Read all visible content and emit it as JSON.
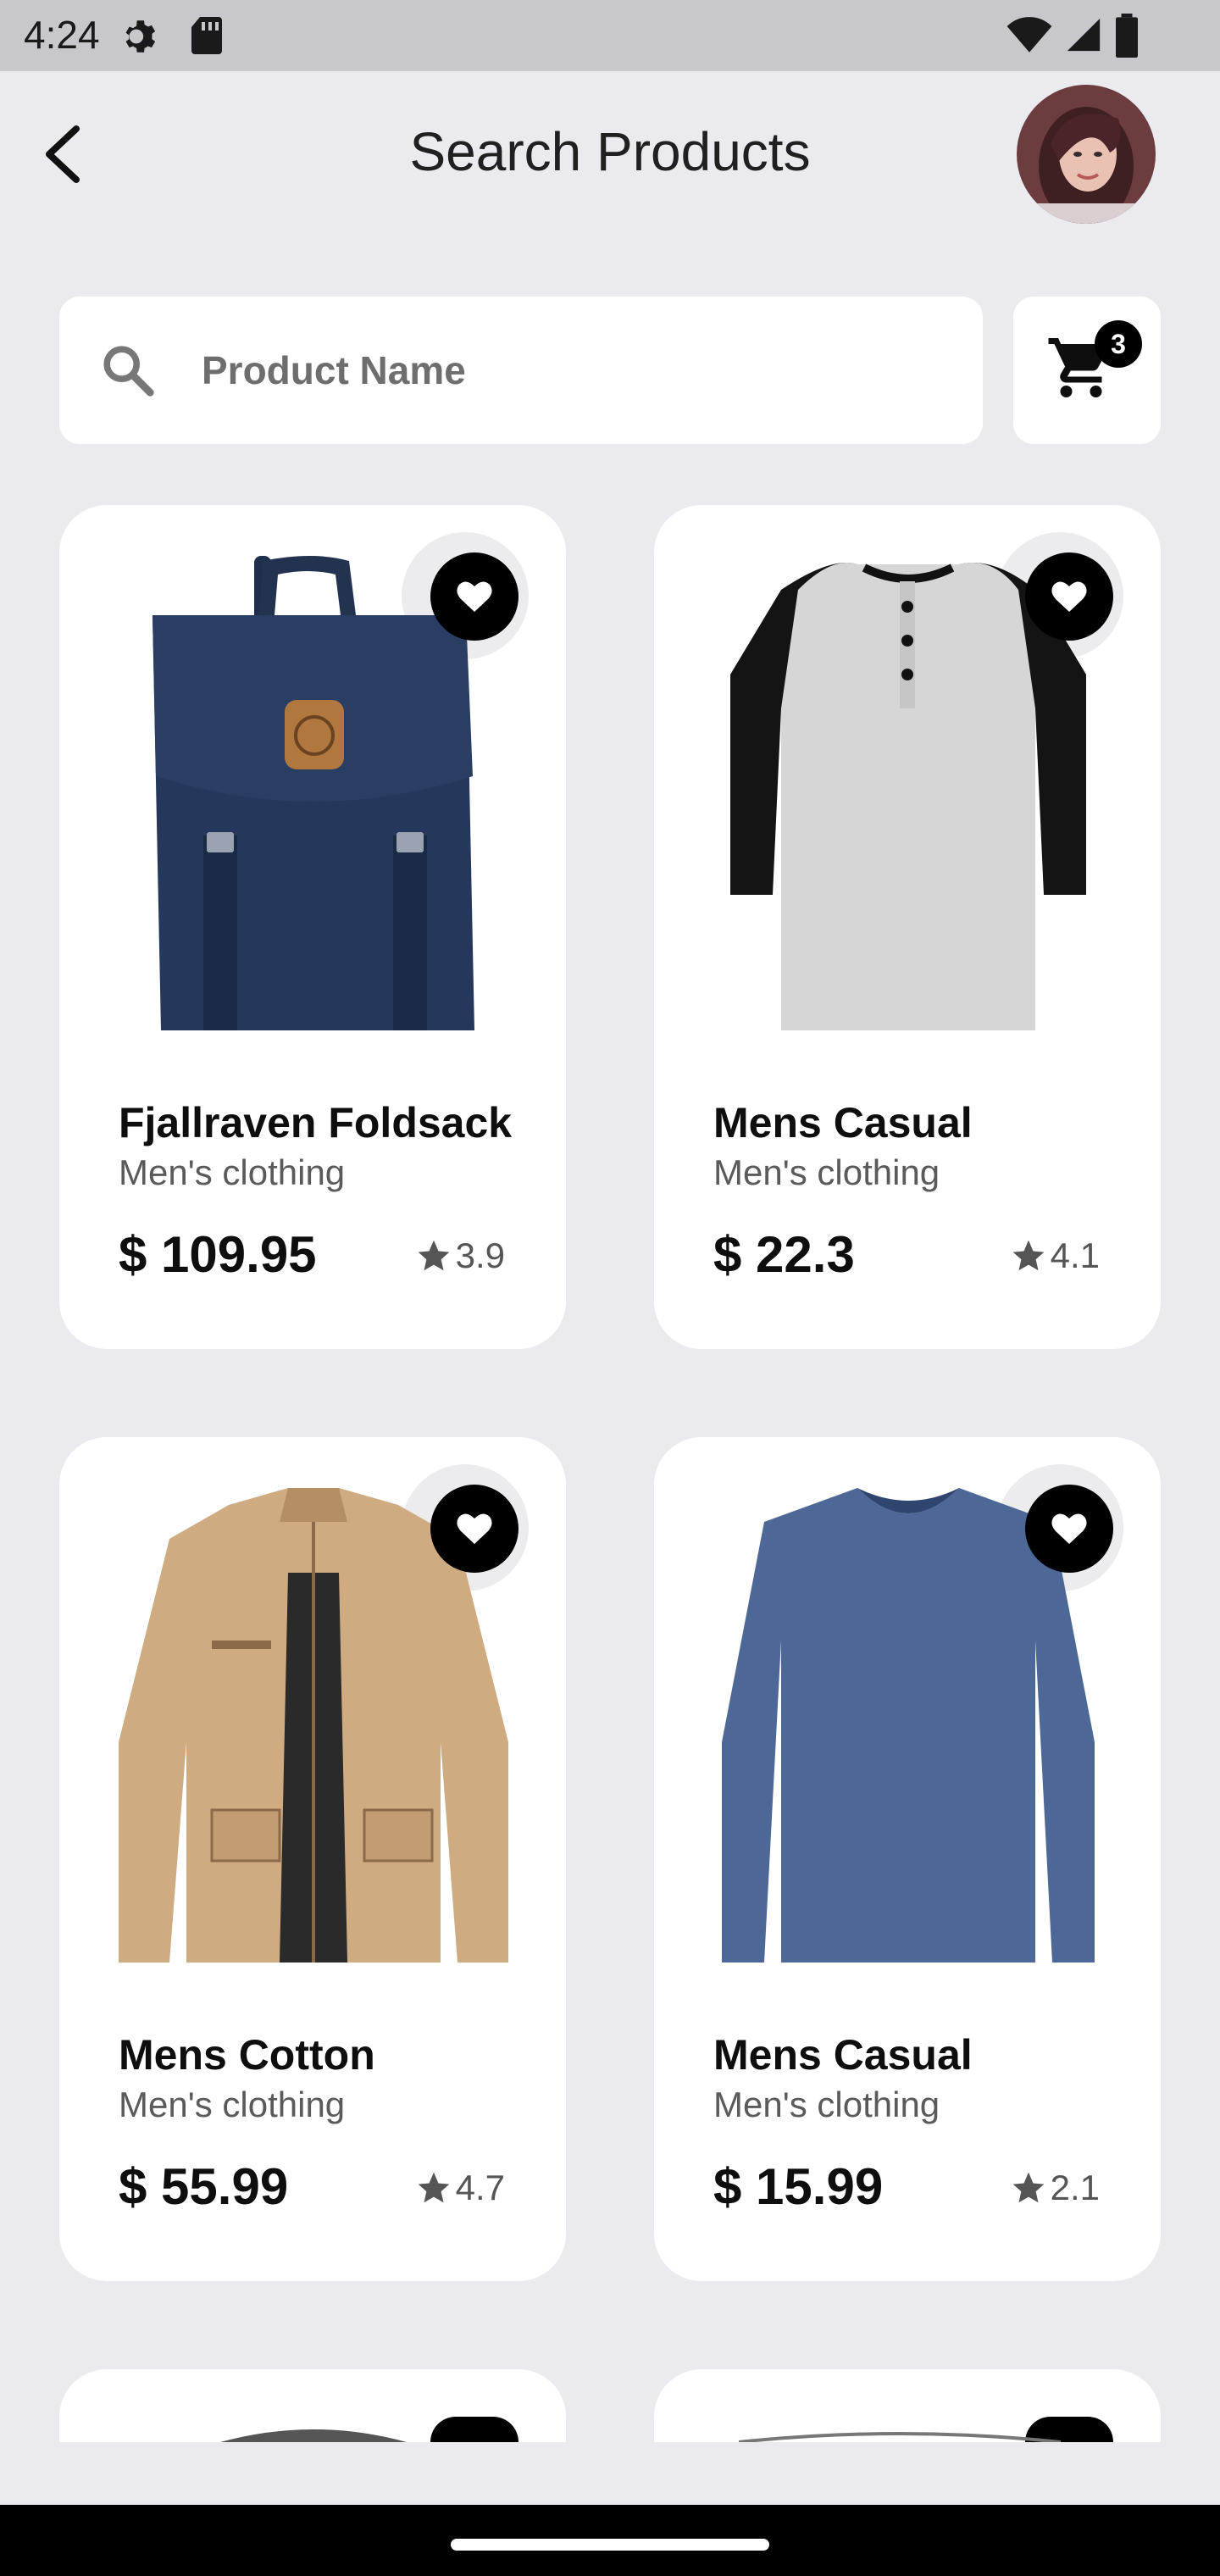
{
  "status_bar": {
    "time": "4:24"
  },
  "header": {
    "title": "Search Products"
  },
  "search": {
    "placeholder": "Product Name"
  },
  "cart": {
    "count": "3"
  },
  "products": [
    {
      "title": "Fjallraven Foldsack",
      "category": "Men's clothing",
      "price": "$ 109.95",
      "rating": "3.9",
      "image": "backpack"
    },
    {
      "title": "Mens Casual",
      "category": "Men's clothing",
      "price": "$ 22.3",
      "rating": "4.1",
      "image": "raglan-tee"
    },
    {
      "title": "Mens Cotton",
      "category": "Men's clothing",
      "price": "$ 55.99",
      "rating": "4.7",
      "image": "jacket"
    },
    {
      "title": "Mens Casual",
      "category": "Men's clothing",
      "price": "$ 15.99",
      "rating": "2.1",
      "image": "long-sleeve-shirt"
    }
  ],
  "colors": {
    "background": "#ebeaee",
    "card": "#ffffff",
    "accent": "#000000",
    "status_bar": "#c8c7cb"
  }
}
